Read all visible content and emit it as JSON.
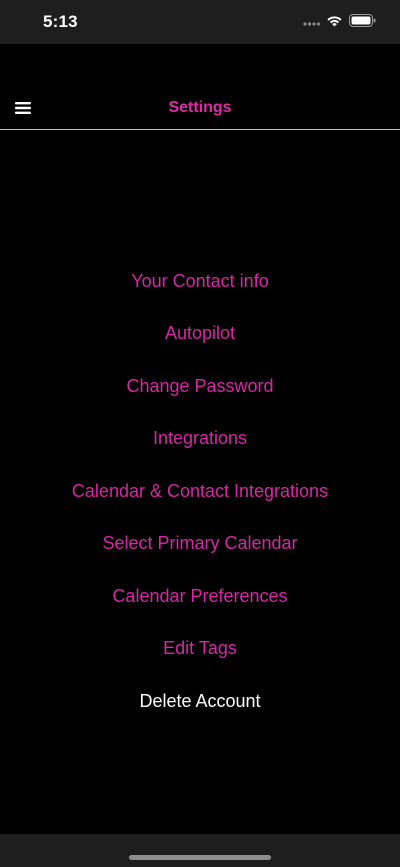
{
  "status_bar": {
    "time": "5:13",
    "icons": [
      "signal-dots-icon",
      "wifi-icon",
      "battery-icon"
    ]
  },
  "nav": {
    "title": "Settings",
    "menu_icon": "hamburger-menu-icon"
  },
  "menu": {
    "items": [
      {
        "label": "Your Contact info"
      },
      {
        "label": "Autopilot"
      },
      {
        "label": "Change Password"
      },
      {
        "label": "Integrations"
      },
      {
        "label": "Calendar & Contact Integrations"
      },
      {
        "label": "Select Primary Calendar"
      },
      {
        "label": "Calendar Preferences"
      },
      {
        "label": "Edit Tags"
      },
      {
        "label": "Delete Account"
      }
    ]
  },
  "colors": {
    "accent": "#d826a6",
    "background": "#000000",
    "bars": "#1e1e1e",
    "divider": "#bdbdbd"
  }
}
